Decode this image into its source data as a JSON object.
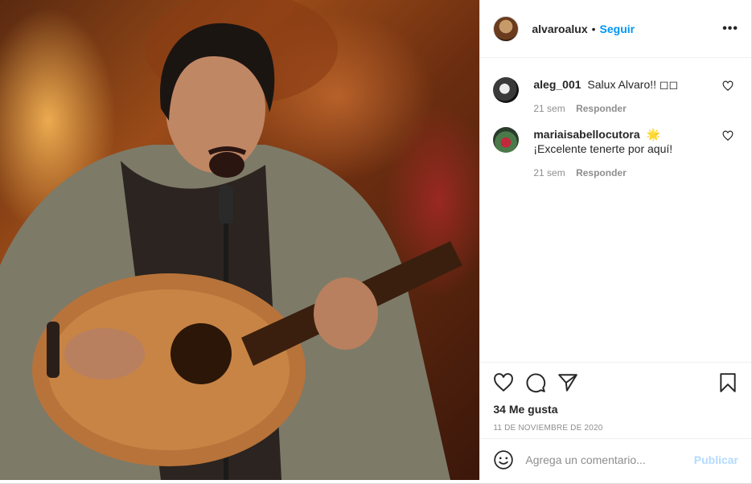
{
  "header": {
    "avatar_icon": "profile-avatar",
    "username": "alvaroalux",
    "separator": "•",
    "follow_label": "Seguir",
    "more_icon": "more-options-icon",
    "more_label": "•••"
  },
  "comments": [
    {
      "username": "aleg_001",
      "text": "Salux Alvaro!! ◻◻",
      "age": "21 sem",
      "reply_label": "Responder",
      "like_icon": "heart-icon"
    },
    {
      "username": "mariaisabellocutora",
      "badge": "🌟",
      "text": "¡Excelente tenerte por aquí!",
      "age": "21 sem",
      "reply_label": "Responder",
      "like_icon": "heart-icon"
    }
  ],
  "actions": {
    "icons": [
      "heart-icon",
      "comment-icon",
      "share-icon",
      "bookmark-icon"
    ]
  },
  "likes_text": "34 Me gusta",
  "date_text": "11 de noviembre de 2020",
  "composer": {
    "placeholder": "Agrega un comentario...",
    "publish_label": "Publicar",
    "emoji_icon": "smiley-icon"
  },
  "colors": {
    "link_blue": "#0095f6",
    "publish_disabled": "#b3dbff",
    "muted_text": "#8e8e8e"
  }
}
